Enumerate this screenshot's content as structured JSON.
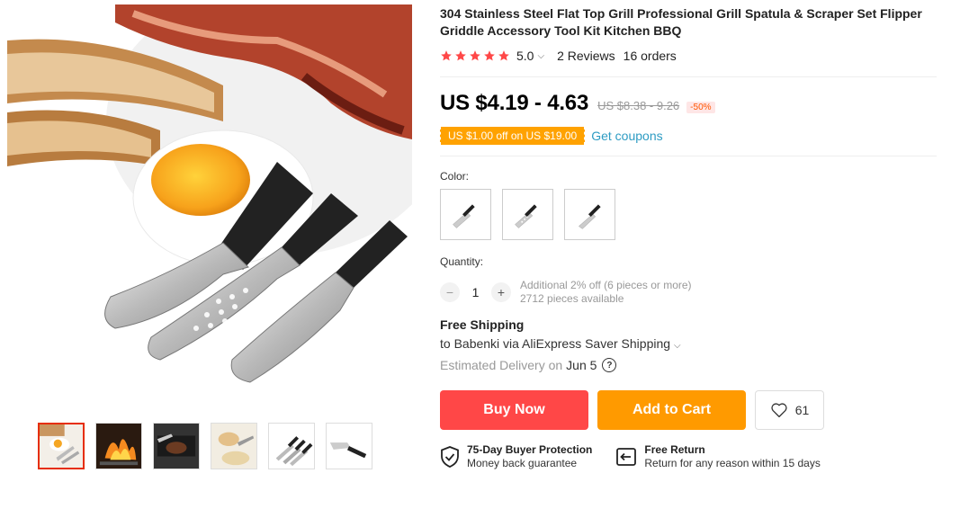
{
  "product": {
    "title": "304 Stainless Steel Flat Top Grill Professional Grill Spatula & Scraper Set Flipper Griddle Accessory Tool Kit Kitchen BBQ",
    "rating": "5.0",
    "reviews": "2 Reviews",
    "orders": "16 orders",
    "star_color": "#ff4747"
  },
  "price": {
    "current": "US $4.19 - 4.63",
    "original": "US $8.38 - 9.26",
    "discount": "-50%"
  },
  "coupon": {
    "badge": "US $1.00 off on US $19.00",
    "link": "Get coupons"
  },
  "sku": {
    "color_label": "Color:",
    "swatch_count": 3
  },
  "quantity": {
    "label": "Quantity:",
    "value": "1",
    "minus": "−",
    "plus": "+",
    "bulk_note": "Additional 2% off (6 pieces or more)",
    "available": "2712 pieces available"
  },
  "shipping": {
    "title": "Free Shipping",
    "line": "to Babenki via AliExpress Saver Shipping",
    "delivery_label": "Estimated Delivery on",
    "delivery_date": "Jun 5",
    "help": "?"
  },
  "actions": {
    "buy_now": "Buy Now",
    "add_to_cart": "Add to Cart",
    "wishlist_count": "61",
    "buy_color": "#ff4747",
    "cart_color": "#ff9a00"
  },
  "guarantees": [
    {
      "title": "75-Day Buyer Protection",
      "subtitle": "Money back guarantee",
      "icon": "shield-check-icon"
    },
    {
      "title": "Free Return",
      "subtitle": "Return for any reason within 15 days",
      "icon": "return-icon"
    }
  ]
}
